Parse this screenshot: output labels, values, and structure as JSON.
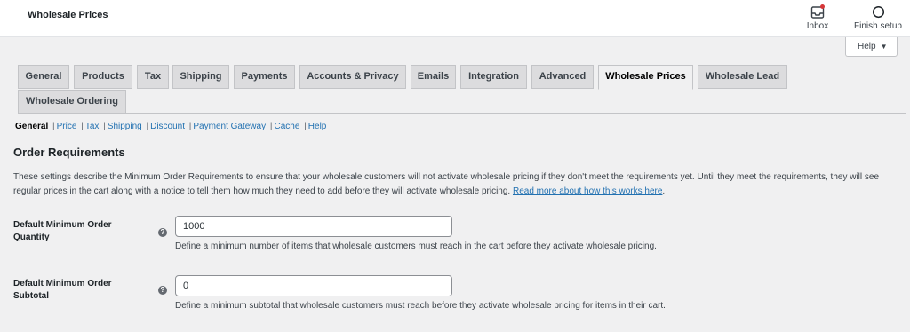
{
  "header": {
    "title": "Wholesale Prices",
    "inbox_label": "Inbox",
    "finish_label": "Finish setup",
    "notification_color": "#d63638"
  },
  "help": {
    "label": "Help",
    "caret": "▼"
  },
  "tabs": [
    {
      "label": "General"
    },
    {
      "label": "Products"
    },
    {
      "label": "Tax"
    },
    {
      "label": "Shipping"
    },
    {
      "label": "Payments"
    },
    {
      "label": "Accounts & Privacy"
    },
    {
      "label": "Emails"
    },
    {
      "label": "Integration"
    },
    {
      "label": "Advanced"
    },
    {
      "label": "Wholesale Prices",
      "active": true
    },
    {
      "label": "Wholesale Lead"
    },
    {
      "label": "Wholesale Ordering"
    }
  ],
  "subnav": {
    "current": "General",
    "items": [
      "Price",
      "Tax",
      "Shipping",
      "Discount",
      "Payment Gateway",
      "Cache",
      "Help"
    ]
  },
  "section": {
    "title": "Order Requirements",
    "description": "These settings describe the Minimum Order Requirements to ensure that your wholesale customers will not activate wholesale pricing if they don't meet the requirements yet. Until they meet the requirements, they will see regular prices in the cart along with a notice to tell them how much they need to add before they will activate wholesale pricing.",
    "read_more": "Read more about how this works here"
  },
  "fields": {
    "min_qty": {
      "label": "Default Minimum Order Quantity",
      "value": "1000",
      "help": "Define a minimum number of items that wholesale customers must reach in the cart before they activate wholesale pricing."
    },
    "min_subtotal": {
      "label": "Default Minimum Order Subtotal",
      "value": "0",
      "help": "Define a minimum subtotal that wholesale customers must reach before they activate wholesale pricing for items in their cart."
    }
  },
  "icons": {
    "tooltip": "?"
  }
}
